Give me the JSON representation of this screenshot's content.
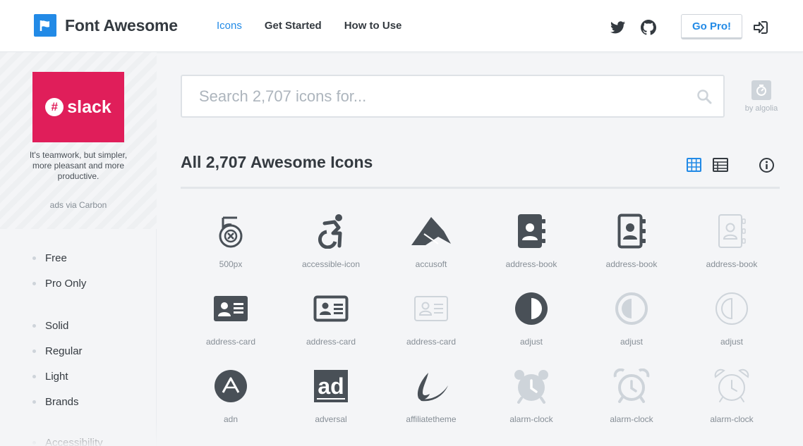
{
  "header": {
    "brand": "Font Awesome",
    "nav": [
      {
        "label": "Icons",
        "active": true
      },
      {
        "label": "Get Started",
        "active": false
      },
      {
        "label": "How to Use",
        "active": false
      }
    ],
    "go_pro_label": "Go Pro!",
    "accent_color": "#228ae6"
  },
  "sidebar": {
    "ad": {
      "brand": "slack",
      "text": "It's teamwork, but simpler, more pleasant and more productive.",
      "via": "ads via Carbon"
    },
    "filters": [
      "Free",
      "Pro Only",
      "Solid",
      "Regular",
      "Light",
      "Brands",
      "Accessibility"
    ]
  },
  "search": {
    "placeholder": "Search 2,707 icons for...",
    "algolia_label": "by algolia"
  },
  "main": {
    "title": "All 2,707 Awesome Icons",
    "icons": [
      {
        "name": "500px",
        "icon": "500px-icon"
      },
      {
        "name": "accessible-icon",
        "icon": "accessible-icon"
      },
      {
        "name": "accusoft",
        "icon": "accusoft-icon"
      },
      {
        "name": "address-book",
        "icon": "address-book-solid-icon"
      },
      {
        "name": "address-book",
        "icon": "address-book-regular-icon"
      },
      {
        "name": "address-book",
        "icon": "address-book-light-icon"
      },
      {
        "name": "address-card",
        "icon": "address-card-solid-icon"
      },
      {
        "name": "address-card",
        "icon": "address-card-regular-icon"
      },
      {
        "name": "address-card",
        "icon": "address-card-light-icon"
      },
      {
        "name": "adjust",
        "icon": "adjust-solid-icon"
      },
      {
        "name": "adjust",
        "icon": "adjust-regular-icon"
      },
      {
        "name": "adjust",
        "icon": "adjust-light-icon"
      },
      {
        "name": "adn",
        "icon": "adn-icon"
      },
      {
        "name": "adversal",
        "icon": "adversal-icon"
      },
      {
        "name": "affiliatetheme",
        "icon": "affiliatetheme-icon"
      },
      {
        "name": "alarm-clock",
        "icon": "alarm-clock-solid-icon"
      },
      {
        "name": "alarm-clock",
        "icon": "alarm-clock-regular-icon"
      },
      {
        "name": "alarm-clock",
        "icon": "alarm-clock-light-icon"
      }
    ]
  }
}
